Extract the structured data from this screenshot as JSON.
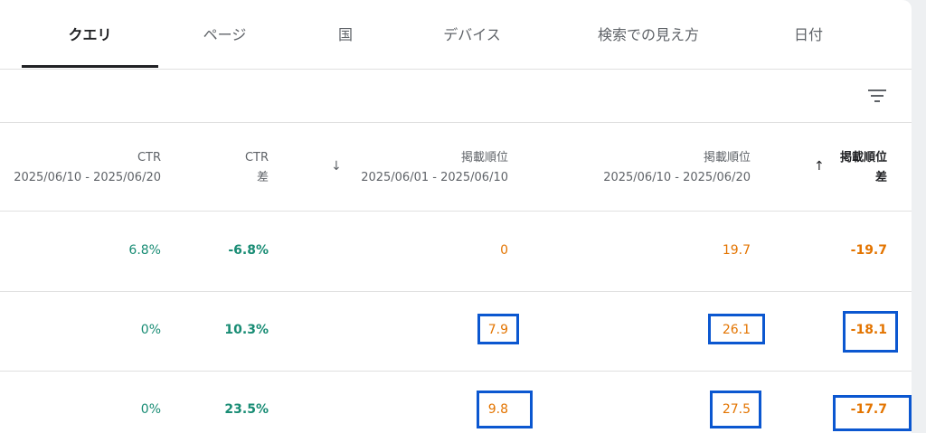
{
  "tabs": [
    {
      "label": "クエリ",
      "active": true
    },
    {
      "label": "ページ",
      "active": false
    },
    {
      "label": "国",
      "active": false
    },
    {
      "label": "デバイス",
      "active": false
    },
    {
      "label": "検索での見え方",
      "active": false
    },
    {
      "label": "日付",
      "active": false
    }
  ],
  "filter": {
    "icon": "filter-list-icon"
  },
  "columns": {
    "ctr_curr": {
      "line1": "CTR",
      "line2": "2025/06/10 - 2025/06/20"
    },
    "ctr_diff": {
      "line1": "CTR",
      "line2": "差"
    },
    "pos_prev": {
      "line1": "掲載順位",
      "line2": "2025/06/01 - 2025/06/10",
      "arrow": "↓"
    },
    "pos_curr": {
      "line1": "掲載順位",
      "line2": "2025/06/10 - 2025/06/20"
    },
    "pos_diff": {
      "line1": "掲載順位",
      "line2": "差",
      "arrow": "↑"
    }
  },
  "rows": [
    {
      "ctr_curr": "6.8%",
      "ctr_diff": "-6.8%",
      "pos_prev": "0",
      "pos_curr": "19.7",
      "pos_diff": "-19.7"
    },
    {
      "ctr_curr": "0%",
      "ctr_diff": "10.3%",
      "pos_prev": "7.9",
      "pos_curr": "26.1",
      "pos_diff": "-18.1"
    },
    {
      "ctr_curr": "0%",
      "ctr_diff": "23.5%",
      "pos_prev": "9.8",
      "pos_curr": "27.5",
      "pos_diff": "-17.7"
    }
  ],
  "colors": {
    "ctr": "#188038",
    "position": "#e37400",
    "highlight": "#0b57d0"
  }
}
